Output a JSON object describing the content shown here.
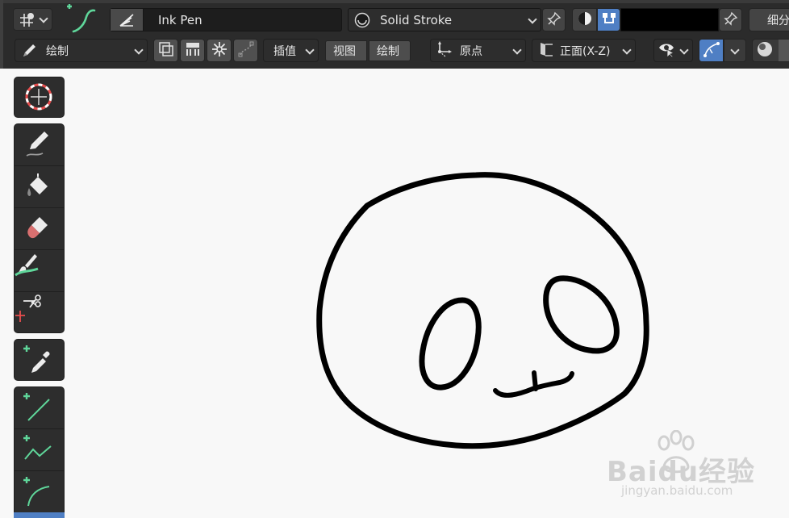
{
  "header": {
    "brush_name": "Ink Pen",
    "material_name": "Solid Stroke",
    "right_cut_label": "细分"
  },
  "toolbar": {
    "mode_label": "绘制",
    "interpolate_label": "插值",
    "view_label": "视图",
    "draw_label": "绘制",
    "origin_label": "原点",
    "orientation_label": "正面(X-Z)"
  },
  "toolshelf": {
    "items": [
      "cursor",
      "draw",
      "fill",
      "erase",
      "tint",
      "cutter",
      "eyedropper",
      "line",
      "polyline",
      "arc"
    ]
  },
  "watermark": {
    "brand_top": "Baidu经验",
    "brand_bottom": "jingyan.baidu.com"
  },
  "colors": {
    "accent_blue": "#4f7fc4",
    "stroke_green": "#5fd69a",
    "viewport_bg": "#f8f8f8"
  }
}
